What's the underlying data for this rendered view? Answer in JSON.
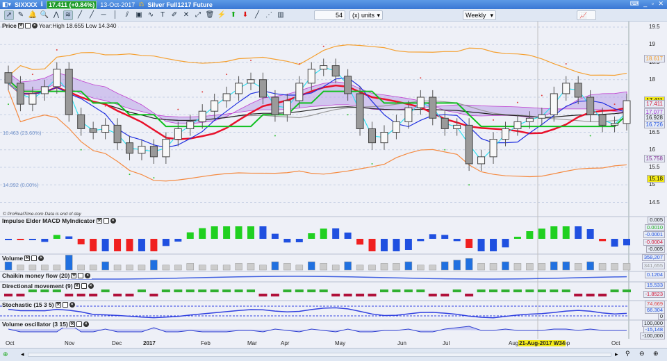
{
  "titlebar": {
    "symbol": "SIXXXX",
    "price_badge": "17.411 (+0.84%)",
    "date": "13-Oct-2017",
    "instrument": "Silver Full1217 Future",
    "window_controls": "⌨ _ ▫ ✕"
  },
  "toolbar": {
    "icons": [
      "pointer",
      "eraser",
      "alert-bell",
      "magnifier",
      "fibonacci",
      "channel",
      "line-segment",
      "trend-line",
      "horizontal-line",
      "vertical-line",
      "parallel-lines",
      "regression",
      "wave",
      "text",
      "pencil",
      "cross-line",
      "arrow-line",
      "trash",
      "fan",
      "up-arrow",
      "down-arrow",
      "gann-line",
      "gann-fan",
      "gann-grid"
    ],
    "units_value": "54",
    "units_select": "(x) units",
    "period_select": "Weekly"
  },
  "price_panel": {
    "label": "Price",
    "info": "Year:High 18.655 Low 14.340",
    "credit": "© ProRealTime.com  Data is end of day",
    "fib": [
      "16.463 (23.60%)",
      "14.992 (0.00%)"
    ],
    "ticks": [
      "19.5",
      "19",
      "18.5",
      "18",
      "16.5",
      "16",
      "15.5",
      "15",
      "14.5"
    ],
    "tags": [
      {
        "text": "18.617",
        "color": "#f39a2a",
        "bg": "#e6ebf5",
        "p": 18.617
      },
      {
        "text": "17.411",
        "color": "#000",
        "bg": "#f3ea18",
        "p": 17.411
      },
      {
        "text": "17.411",
        "color": "#d01030",
        "bg": "#e6ebf5",
        "p": 17.33
      },
      {
        "text": "17.077",
        "color": "#9a2bd0",
        "bg": "#e6ebf5",
        "p": 17.077
      },
      {
        "text": "16.928",
        "color": "#222",
        "bg": "#e6ebf5",
        "p": 16.928
      },
      {
        "text": "16.726",
        "color": "#2050e0",
        "bg": "#e6ebf5",
        "p": 16.726
      },
      {
        "text": "15.758",
        "color": "#803090",
        "bg": "#e6ebf5",
        "p": 15.758
      },
      {
        "text": "15.18",
        "color": "#000",
        "bg": "#f3ea18",
        "p": 15.18
      }
    ]
  },
  "panels": [
    {
      "label": "Impulse Elder MACD MyIndicator",
      "tags": [
        {
          "text": "0.005",
          "c": "#222"
        },
        {
          "text": "0.0010",
          "c": "#20b020"
        },
        {
          "text": "-0.0001",
          "c": "#2050e0"
        },
        {
          "text": "-0.0004",
          "c": "#d01030"
        },
        {
          "text": "-0.005",
          "c": "#222"
        }
      ]
    },
    {
      "label": "Volume",
      "tags": [
        {
          "text": "358,207",
          "c": "#2050e0"
        },
        {
          "text": "341,655",
          "c": "#999"
        }
      ]
    },
    {
      "label": "Chaikin money flow (20)",
      "tags": [
        {
          "text": "0.1204",
          "c": "#2050e0"
        }
      ]
    },
    {
      "label": "Directional movement (9)",
      "tags": [
        {
          "text": "15.533",
          "c": "#2050e0"
        },
        {
          "text": "-1.8523",
          "c": "#d01030"
        }
      ]
    },
    {
      "label": "Stochastic (15 3 5)",
      "tags": [
        {
          "text": "74.669",
          "c": "#e04040"
        },
        {
          "text": "66.304",
          "c": "#2050e0"
        },
        {
          "text": "0",
          "c": "#222"
        }
      ]
    },
    {
      "label": "Volume oscillator (3 15)",
      "tags": [
        {
          "text": "100,000",
          "c": "#222"
        },
        {
          "text": "-15,148",
          "c": "#2050e0"
        },
        {
          "text": "-100,000",
          "c": "#222"
        }
      ]
    }
  ],
  "xaxis": {
    "months": [
      "Oct",
      "Nov",
      "Dec",
      "2017",
      "Feb",
      "Mar",
      "Apr",
      "May",
      "Jun",
      "Jul",
      "Aug",
      "Sep",
      "Oct"
    ],
    "cursor_label": "21-Aug-2017 W34"
  },
  "chart_data": {
    "type": "candlestick",
    "period": "Weekly",
    "ylim": [
      14.3,
      19.7
    ],
    "closes": [
      17.9,
      17.3,
      17.6,
      17.8,
      18.3,
      17.0,
      16.6,
      16.5,
      16.7,
      16.2,
      15.9,
      16.1,
      15.8,
      16.3,
      16.6,
      16.8,
      17.1,
      17.4,
      17.6,
      17.9,
      18.0,
      17.5,
      17.0,
      17.4,
      17.9,
      18.3,
      18.4,
      18.1,
      17.6,
      16.6,
      16.2,
      16.5,
      16.8,
      17.2,
      17.5,
      16.9,
      16.6,
      16.7,
      15.6,
      15.8,
      16.3,
      16.6,
      16.8,
      16.9,
      17.0,
      17.6,
      17.9,
      17.5,
      17.0,
      16.7,
      16.75,
      17.4
    ],
    "volume": [
      5,
      3,
      3,
      3,
      3,
      9,
      3,
      3,
      5,
      3,
      3,
      3,
      6,
      3,
      3,
      4,
      3,
      3,
      3,
      4,
      4,
      3,
      5,
      4,
      3,
      5,
      4,
      3,
      5,
      3,
      3,
      4,
      4,
      5,
      3,
      3,
      5,
      6,
      7,
      4,
      4,
      5,
      4,
      4,
      4,
      5,
      5,
      4,
      5,
      4,
      4,
      4
    ]
  }
}
